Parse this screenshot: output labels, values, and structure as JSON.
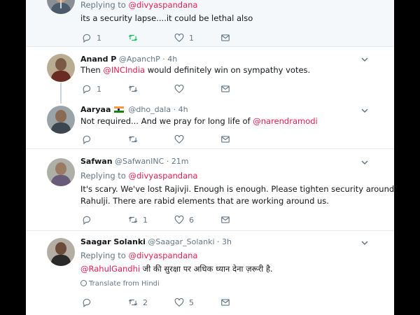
{
  "colors": {
    "link": "#e81c4f",
    "muted": "#657786",
    "retweet_active": "#17bf63",
    "thread_line": "#ccd6dd"
  },
  "tweet0": {
    "replying_label": "Replying to",
    "replying_handle": "@divyaspandana",
    "text": "its a security lapse....it could be lethal also",
    "replies": "1",
    "retweets": "",
    "likes": "1"
  },
  "tweet1": {
    "name": "Anand P",
    "handle": "@ApanchP",
    "dot": "·",
    "time": "4h",
    "text_a": "Then ",
    "text_mention": "@INCIndia",
    "text_b": " would definitely win on sympathy votes.",
    "replies": "1",
    "retweets": "",
    "likes": ""
  },
  "tweet2": {
    "name": "Aaryaa",
    "flag_icon": "india-flag-icon",
    "handle": "@dho_dala",
    "dot": "·",
    "time": "4h",
    "text_a": "Not required... And we pray for long life of ",
    "text_mention": "@narendramodi",
    "replies": "",
    "retweets": "",
    "likes": ""
  },
  "tweet3": {
    "name": "Safwan",
    "handle": "@SafwanINC",
    "dot": "·",
    "time": "21m",
    "replying_label": "Replying to",
    "replying_handle": "@divyaspandana",
    "text_line1": "It's scary. We've lost Rajivji. Enough is enough. Please tighten security around",
    "text_line2": "Rahulji. There are rabid elements that are working around us.",
    "replies": "",
    "retweets": "1",
    "likes": "6"
  },
  "tweet4": {
    "name": "Saagar Solanki",
    "handle": "@Saagar_Solanki",
    "dot": "·",
    "time": "3h",
    "replying_label": "Replying to",
    "replying_handle": "@divyaspandana",
    "text_mention": "@RahulGandhi",
    "text_rest": " जी की सुरक्षा पर अधिक ध्यान देना ज़रूरी है.",
    "translate_label": "Translate from Hindi",
    "replies": "",
    "retweets": "2",
    "likes": "5"
  }
}
